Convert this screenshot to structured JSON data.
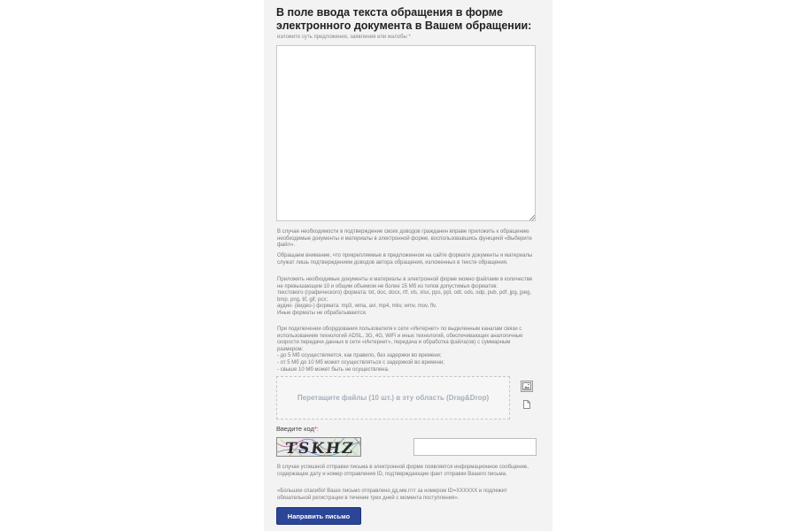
{
  "form": {
    "heading": "В поле ввода текста обращения в форме электронного документа в Вашем обращении:",
    "message_hint": "изложите суть предложения, заявления или жалобы *",
    "message_value": ""
  },
  "info_paragraphs": [
    "В случае необходимости в подтверждение своих доводов гражданин вправе приложить к обращению необходимые документы и материалы в электронной форме, воспользовавшись функцией «Выберите файл».",
    "Обращаем внимание, что прикрепляемые в предложенном на сайте формате документы и материалы служат лишь подтверждением доводов автора обращения, изложенных в тексте обращения."
  ],
  "formats": {
    "lines": [
      "Приложить необходимые документы и материалы в электронной форме можно файлами в количестве не превышающем 10 и общим объемом не более 15 Мб из типов допустимых форматов:",
      "текстового (графического) формата: txt, doc, docx, rtf, xls, xlsx, pps, ppt, odt, ods, odp, pub, pdf, jpg, jpeg, bmp, png, tif, gif, pcx;",
      "аудио- (видео-) формата: mp3, wma, avi, mp4, mkv, wmv, mov, flv.",
      "Иные форматы не обрабатываются."
    ]
  },
  "speed": {
    "lines": [
      "При подключении оборудования пользователя к сети «Интернет» по выделенным каналам связи с использованием технологий ADSL, 3G, 4G, WiFi и иных технологий, обеспечивающих аналогичные скорости передачи данных в сети «Интернет», передача и обработка файла(ов) с суммарным размером:",
      "- до 5 Мб осуществляется, как правило, без задержки во времени;",
      "- от 5 Мб до 10 Мб может осуществляться с задержкой во времени;",
      "- свыше 10 Мб может быть не осуществлена."
    ]
  },
  "upload": {
    "drop_label": "Перетащите файлы (10 шт.) в эту область (Drag&Drop)",
    "image_icon": "image-icon",
    "file_icon": "document-icon"
  },
  "captcha": {
    "label": "Введите код",
    "required_mark": "*:",
    "text": "TSKHZ",
    "input_value": ""
  },
  "after": {
    "lines": [
      "В случае успешной отправки письма в электронной форме появляется информационное сообщение, содержащее дату и номер отправления ID, подтверждающие факт отправки Вашего письма.",
      "«Большое спасибо! Ваше письмо отправлено дд.мм.гггг за номером ID=XXXXXX и подлежит обязательной регистрации в течение трех дней с момента поступления»."
    ]
  },
  "submit": {
    "label": "Направить письмо"
  },
  "colors": {
    "panel": "#f3f3f3",
    "button": "#2b4597",
    "drop_text": "#a6b0ba",
    "required": "#c23434"
  }
}
